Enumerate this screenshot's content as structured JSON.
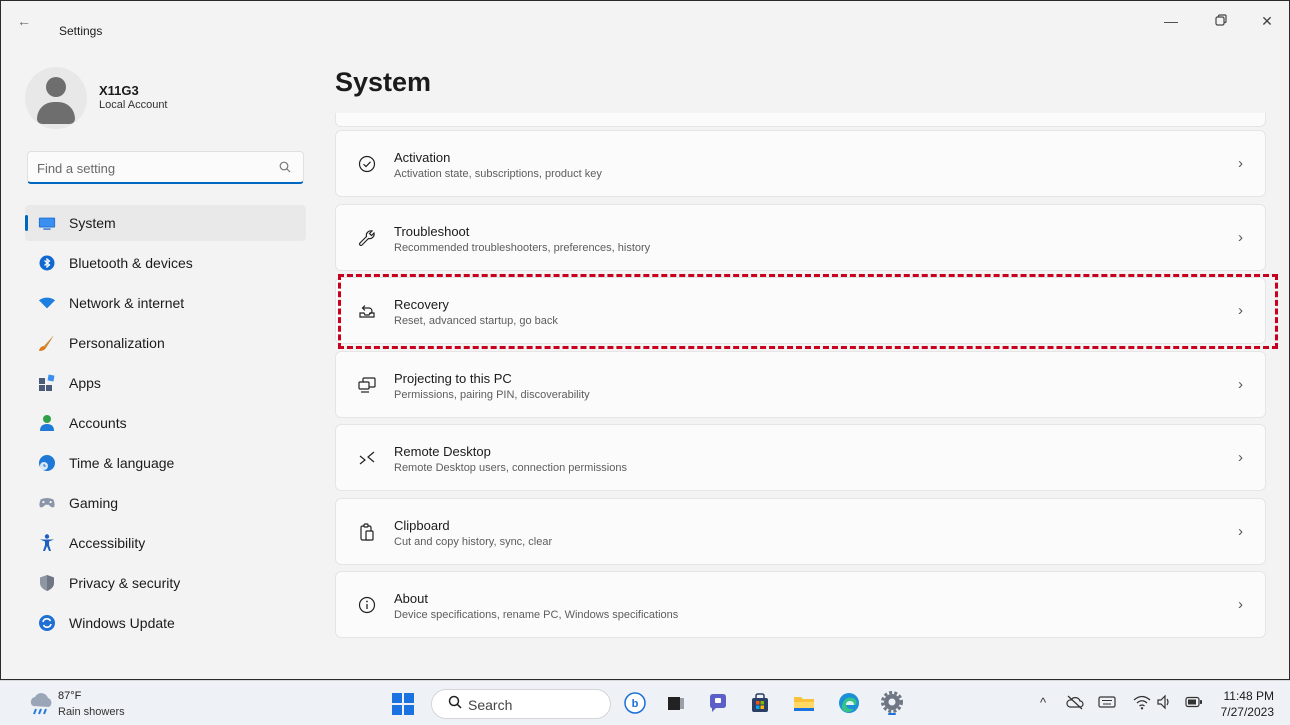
{
  "window": {
    "app_title": "Settings",
    "back_glyph": "←",
    "min_glyph": "—",
    "max_glyph": "❐",
    "close_glyph": "✕"
  },
  "profile": {
    "name": "X11G3",
    "account_type": "Local Account"
  },
  "search": {
    "placeholder": "Find a setting",
    "icon": "search-icon"
  },
  "sidebar": {
    "items": [
      {
        "label": "System",
        "icon": "system-icon",
        "active": true
      },
      {
        "label": "Bluetooth & devices",
        "icon": "bluetooth-icon"
      },
      {
        "label": "Network & internet",
        "icon": "wifi-icon"
      },
      {
        "label": "Personalization",
        "icon": "brush-icon"
      },
      {
        "label": "Apps",
        "icon": "apps-icon"
      },
      {
        "label": "Accounts",
        "icon": "person-icon"
      },
      {
        "label": "Time & language",
        "icon": "globe-clock-icon"
      },
      {
        "label": "Gaming",
        "icon": "controller-icon"
      },
      {
        "label": "Accessibility",
        "icon": "accessibility-icon"
      },
      {
        "label": "Privacy & security",
        "icon": "shield-icon"
      },
      {
        "label": "Windows Update",
        "icon": "update-icon"
      }
    ]
  },
  "main": {
    "title": "System",
    "cards": [
      {
        "title": "Activation",
        "subtitle": "Activation state, subscriptions, product key",
        "icon": "check-circle-icon"
      },
      {
        "title": "Troubleshoot",
        "subtitle": "Recommended troubleshooters, preferences, history",
        "icon": "wrench-icon"
      },
      {
        "title": "Recovery",
        "subtitle": "Reset, advanced startup, go back",
        "icon": "recovery-icon",
        "highlighted": true
      },
      {
        "title": "Projecting to this PC",
        "subtitle": "Permissions, pairing PIN, discoverability",
        "icon": "projector-icon"
      },
      {
        "title": "Remote Desktop",
        "subtitle": "Remote Desktop users, connection permissions",
        "icon": "remote-desktop-icon"
      },
      {
        "title": "Clipboard",
        "subtitle": "Cut and copy history, sync, clear",
        "icon": "clipboard-icon"
      },
      {
        "title": "About",
        "subtitle": "Device specifications, rename PC, Windows specifications",
        "icon": "info-icon"
      }
    ],
    "chevron": "›"
  },
  "taskbar": {
    "weather_temp": "87°F",
    "weather_desc": "Rain showers",
    "search_label": "Search",
    "time": "11:48 PM",
    "date": "7/27/2023",
    "tray_chevron": "^",
    "colors": {
      "accent": "#0067c0",
      "highlight": "#c8001e"
    }
  }
}
